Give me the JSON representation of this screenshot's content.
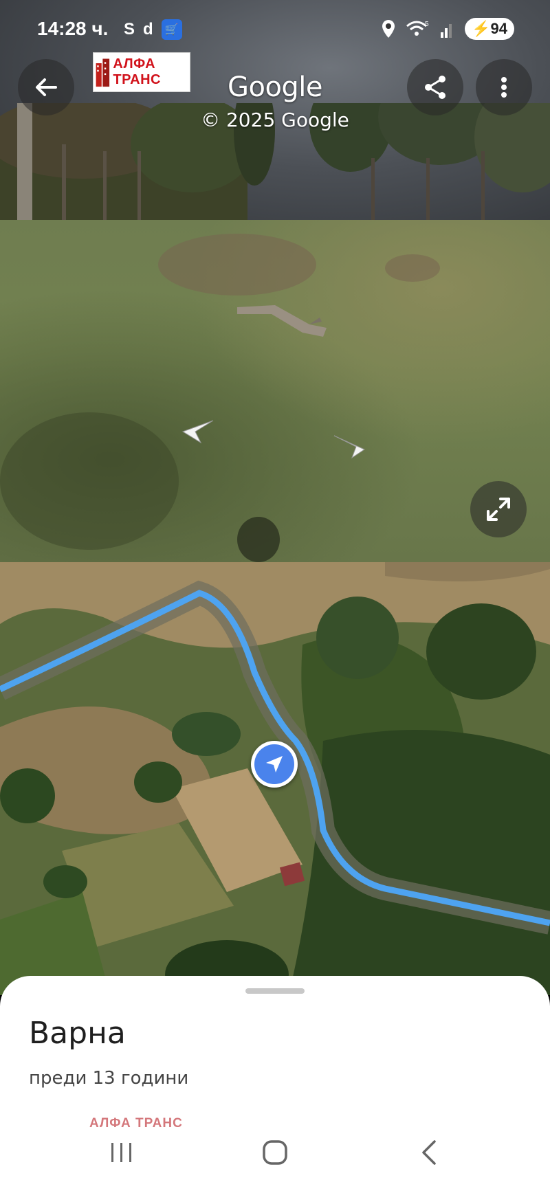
{
  "status_bar": {
    "time": "14:28 ч.",
    "indicator_s": "S",
    "indicator_d": "d",
    "network": "5",
    "battery": "94"
  },
  "logo": {
    "text": "АЛФА ТРАНС"
  },
  "header": {
    "title": "Google",
    "copyright": "© 2025 Google"
  },
  "place": {
    "title": "Варна",
    "subtitle": "преди 13 години"
  },
  "watermark": "АЛФА ТРАНС",
  "colors": {
    "route": "#4ea3f0",
    "marker": "#4a83ec",
    "logo_red": "#d1121b"
  },
  "icons": {
    "back": "arrow-left-icon",
    "share": "share-icon",
    "more": "more-vert-icon",
    "expand": "expand-icon",
    "marker": "navigation-arrow-icon"
  }
}
